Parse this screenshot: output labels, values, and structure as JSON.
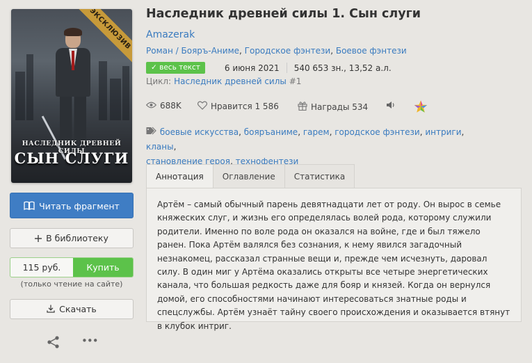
{
  "cover": {
    "badge": "ЭКСКЛЮЗИВ",
    "series_text": "НАСЛЕДНИК ДРЕВНЕЙ СИЛЫ",
    "title_text": "СЫН СЛУГИ"
  },
  "actions": {
    "read_label": "Читать фрагмент",
    "library_label": "В библиотеку",
    "price": "115 руб.",
    "buy_label": "Купить",
    "only_note": "(только чтение на сайте)",
    "download_label": "Скачать"
  },
  "book": {
    "title": "Наследник древней силы 1. Сын слуги",
    "author": "Amazerak",
    "genres": [
      "Роман / Бояръ-Аниме",
      "Городское фэнтези",
      "Боевое фэнтези"
    ],
    "status_badge": "весь текст",
    "date": "6 июня 2021",
    "size": "540 653 зн., 13,52 а.л.",
    "cycle_label": "Цикл:",
    "cycle_name": "Наследник древней силы",
    "cycle_number": "#1"
  },
  "stats": {
    "views": "688K",
    "likes": "Нравится 1 586",
    "awards": "Награды 534"
  },
  "tags": [
    "боевые искусства",
    "бояръаниме",
    "гарем",
    "городское фэнтези",
    "интриги",
    "кланы",
    "становление героя",
    "технофентези"
  ],
  "tabs": [
    "Аннотация",
    "Оглавление",
    "Статистика"
  ],
  "annotation": "Артём – самый обычный парень девятнадцати лет от роду. Он вырос в семье княжеских слуг, и жизнь его определялась волей рода, которому служили родители. Именно по воле рода он оказался на войне, где и был тяжело ранен. Пока Артём валялся без сознания, к нему явился загадочный незнакомец, рассказал странные вещи и, прежде чем исчезнуть, даровал силу. В один миг у Артёма оказались открыты все четыре энергетических канала, что большая редкость даже для бояр и князей. Когда он вернулся домой, его способностями начинают интересоваться знатные роды и спецслужбы. Артём узнаёт тайну своего происхождения и оказывается втянут в клубок интриг.",
  "colors": {
    "primary": "#3f7dc4",
    "link": "#3a7bbf",
    "success": "#5cc24a",
    "background": "#e8e6e2"
  }
}
